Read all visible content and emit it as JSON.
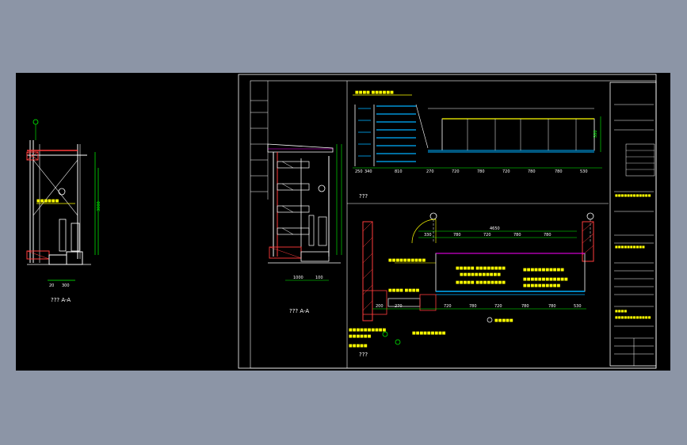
{
  "canvas": {
    "background_color": "#000000",
    "app_background_color": "#8c95a6"
  },
  "colors": {
    "line": "#ffffff",
    "dimension": "#00ff00",
    "annotation": "#ffff00",
    "glass": "#00b0ff",
    "hatch": "#ff3b3b",
    "accent": "#ff00ff"
  },
  "left_detail": {
    "section_label": "??? A-A",
    "dim_left": "20",
    "dim_right": "300",
    "dim_height": "3000"
  },
  "sheet": {
    "section_label": "??? A-A",
    "elevation_label": "???",
    "plan_label": "???",
    "dims_elevation": [
      "250",
      "340",
      "810",
      "270",
      "720",
      "780",
      "720",
      "780",
      "780",
      "530"
    ],
    "dims_plan_top": [
      "330",
      "780",
      "720",
      "780",
      "780"
    ],
    "dims_plan_bottom": [
      "200",
      "270",
      "720",
      "780",
      "720",
      "780",
      "780",
      "530"
    ],
    "dim_total": "4650",
    "dim_height": "580",
    "dim_section_a": "1000",
    "dim_section_b": "100"
  },
  "title_block": {
    "rows": 28
  }
}
